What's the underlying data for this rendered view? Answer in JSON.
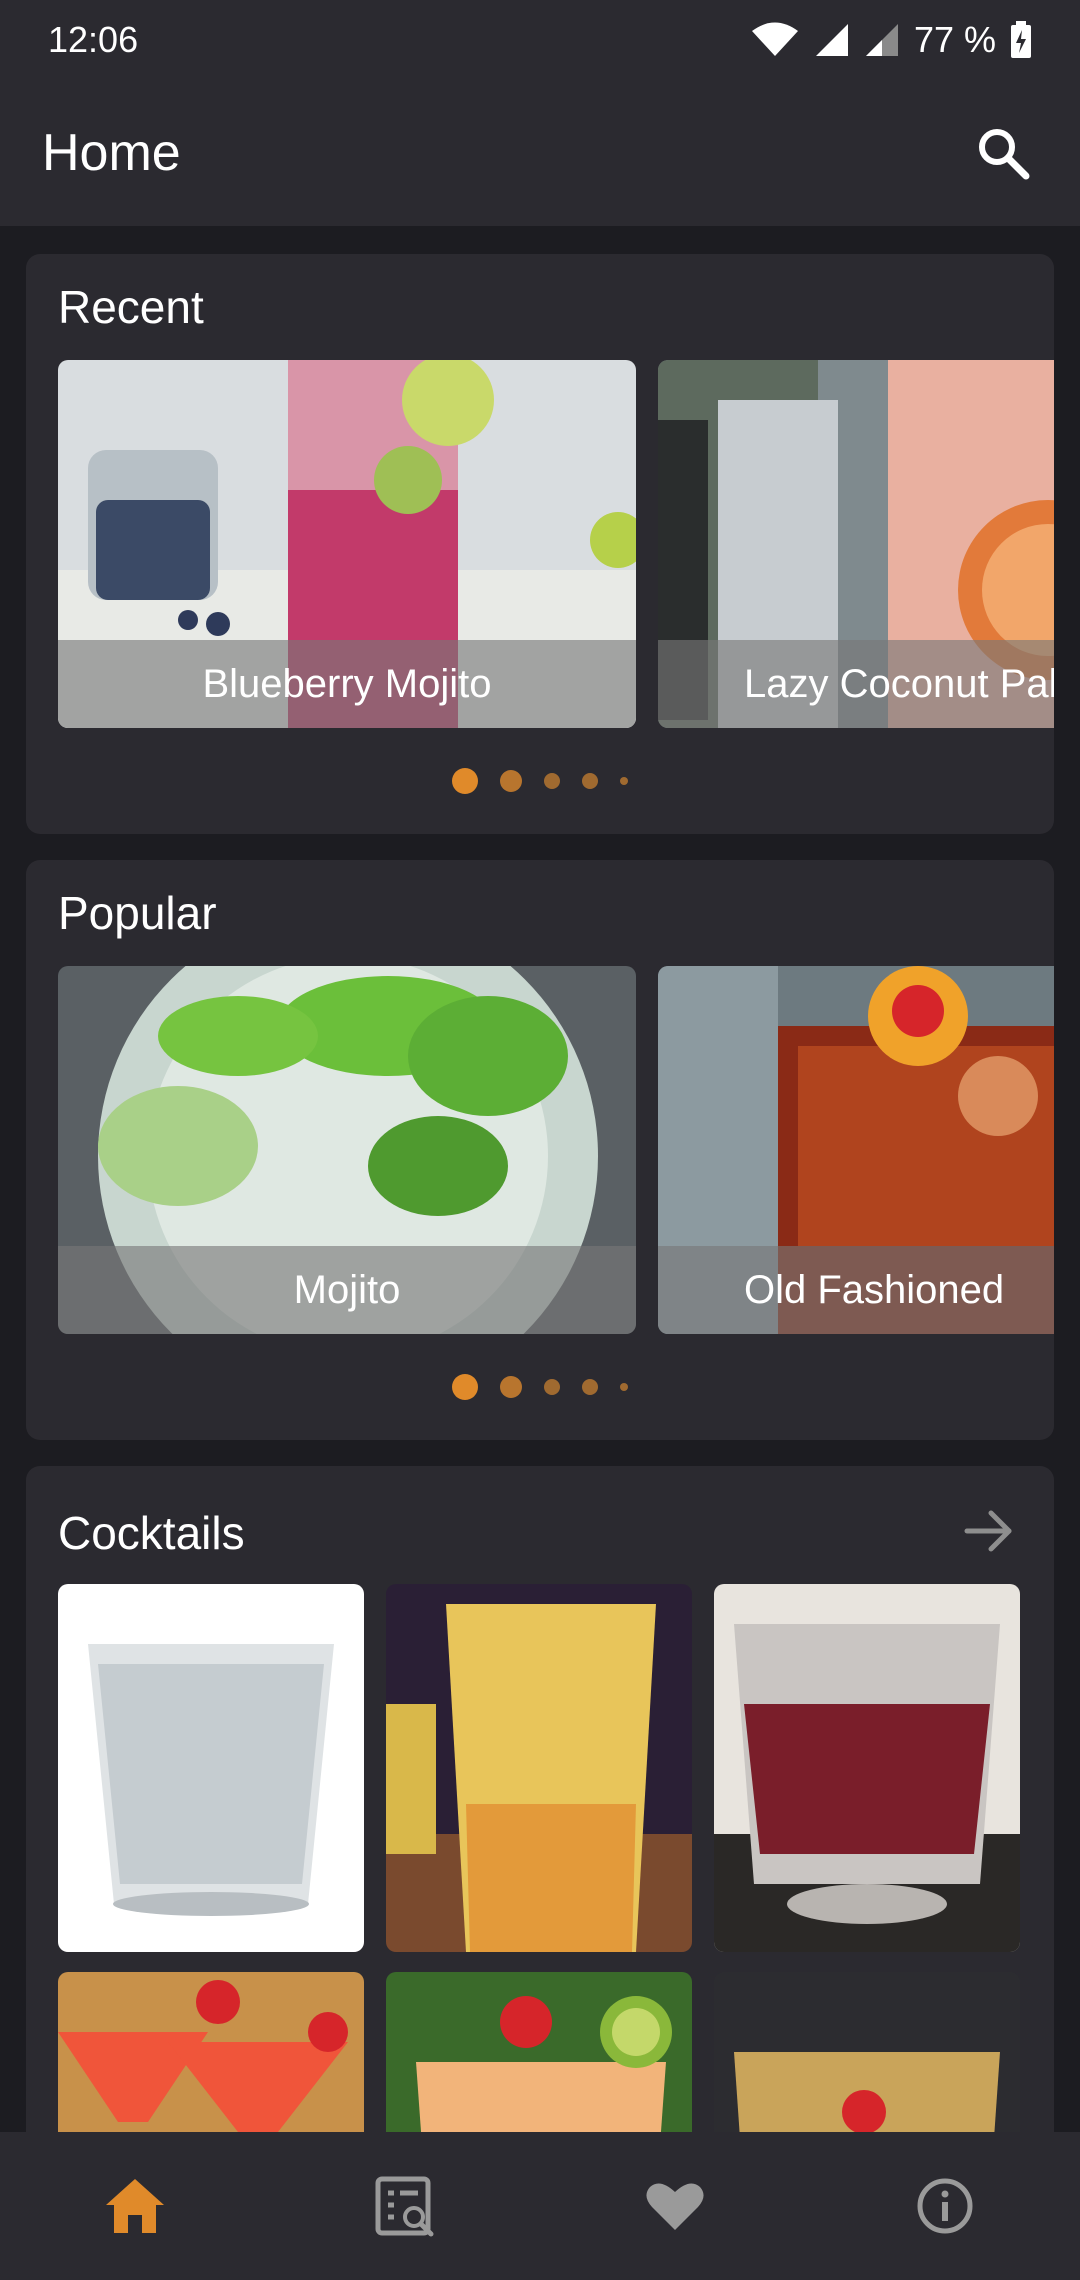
{
  "status_bar": {
    "time": "12:06",
    "battery": "77 %"
  },
  "app_bar": {
    "title": "Home"
  },
  "recent": {
    "title": "Recent",
    "slides": [
      {
        "caption": "Blueberry Mojito"
      },
      {
        "caption": "Lazy Coconut Paloma"
      }
    ],
    "page_count": 5,
    "current_page": 1
  },
  "popular": {
    "title": "Popular",
    "slides": [
      {
        "caption": "Mojito"
      },
      {
        "caption": "Old Fashioned"
      }
    ],
    "page_count": 5,
    "current_page": 1
  },
  "cocktails": {
    "title": "Cocktails"
  },
  "bottom_nav": {
    "items": [
      {
        "icon": "home-icon",
        "active": true
      },
      {
        "icon": "search-list-icon",
        "active": false
      },
      {
        "icon": "heart-icon",
        "active": false
      },
      {
        "icon": "info-icon",
        "active": false
      }
    ]
  },
  "colors": {
    "accent": "#e08a2a",
    "surface": "#2b2a30",
    "background": "#1c1c21"
  }
}
